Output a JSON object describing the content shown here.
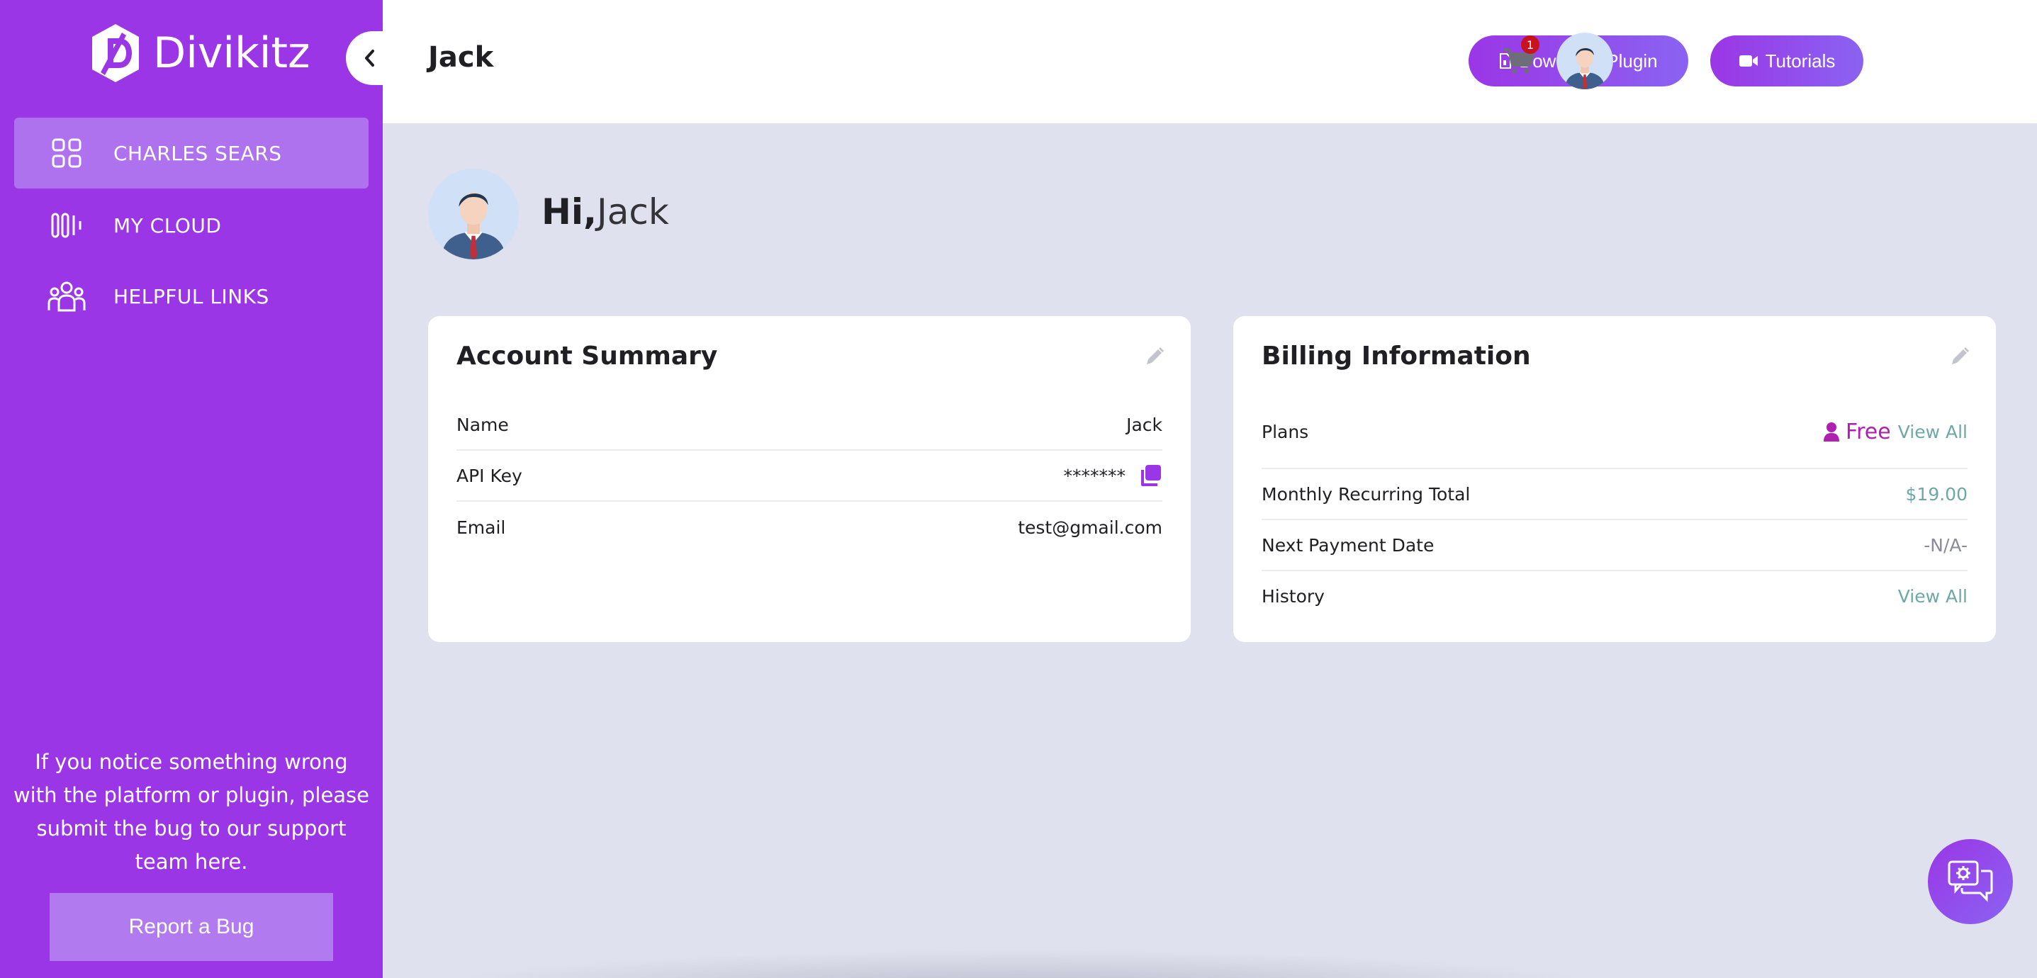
{
  "brand": {
    "name": "Divikitz"
  },
  "sidebar": {
    "items": [
      {
        "label": "CHARLES SEARS",
        "icon": "grid-icon",
        "active": true
      },
      {
        "label": "MY CLOUD",
        "icon": "bars-icon",
        "active": false
      },
      {
        "label": "HELPFUL LINKS",
        "icon": "users-icon",
        "active": false
      }
    ],
    "bug_text": "If you notice something wrong with the platform or plugin, please submit the bug to our support team here.",
    "report_button": "Report a Bug"
  },
  "header": {
    "title": "Jack",
    "download_button": "Download Plugin",
    "tutorials_button": "Tutorials",
    "cart_count": "1"
  },
  "greeting": {
    "hi": "Hi,",
    "name": "Jack"
  },
  "account_summary": {
    "title": "Account Summary",
    "rows": [
      {
        "label": "Name",
        "value": "Jack"
      },
      {
        "label": "API Key",
        "value": "*******"
      },
      {
        "label": "Email",
        "value": "test@gmail.com"
      }
    ]
  },
  "billing": {
    "title": "Billing Information",
    "plans_label": "Plans",
    "plan_value": "Free",
    "plans_link": "View All",
    "mrt_label": "Monthly Recurring Total",
    "mrt_value": "$19.00",
    "next_payment_label": "Next Payment Date",
    "next_payment_value": "-N/A-",
    "history_label": "History",
    "history_link": "View All"
  },
  "colors": {
    "accent": "#9b36e6",
    "accent2": "#8a63f2",
    "link": "#6fa7a7",
    "plan": "#b01fb0",
    "badge": "#c8121d"
  }
}
